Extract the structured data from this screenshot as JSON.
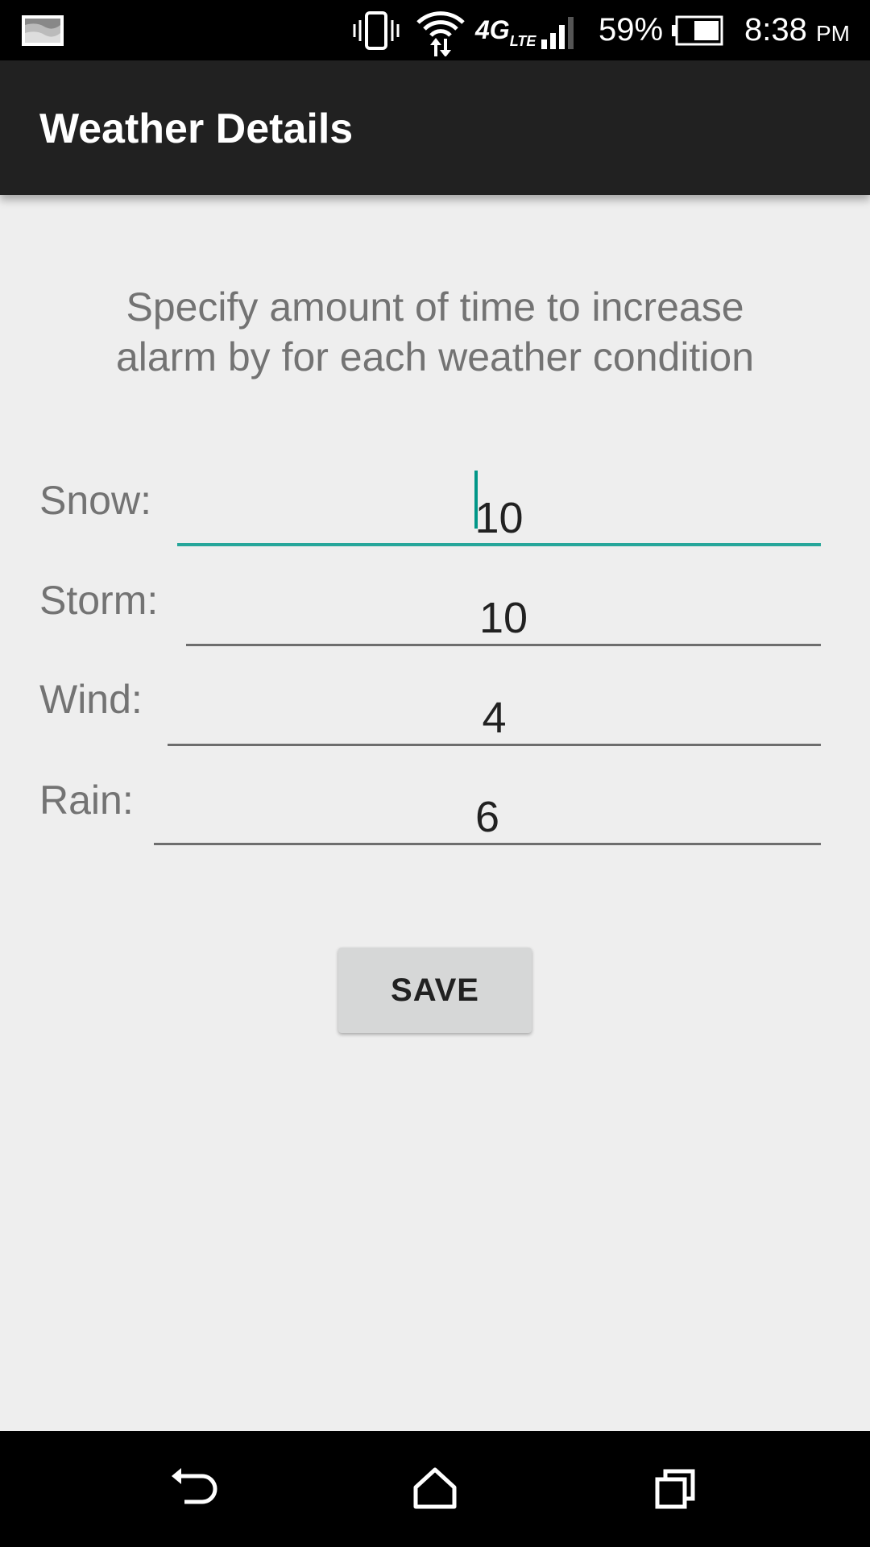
{
  "status_bar": {
    "battery": "59%",
    "time": "8:38",
    "ampm": "PM",
    "network": "4G",
    "network_sub": "LTE"
  },
  "app_bar": {
    "title": "Weather Details"
  },
  "description": {
    "line1": "Specify amount of time to increase",
    "line2": "alarm by for each weather condition"
  },
  "fields": [
    {
      "label": "Snow:",
      "value": "10"
    },
    {
      "label": "Storm:",
      "value": "10"
    },
    {
      "label": "Wind:",
      "value": "4"
    },
    {
      "label": "Rain:",
      "value": "6"
    }
  ],
  "save_label": "SAVE",
  "colors": {
    "accent": "#009688",
    "app_bar": "#212121",
    "background": "#eeeeee"
  }
}
